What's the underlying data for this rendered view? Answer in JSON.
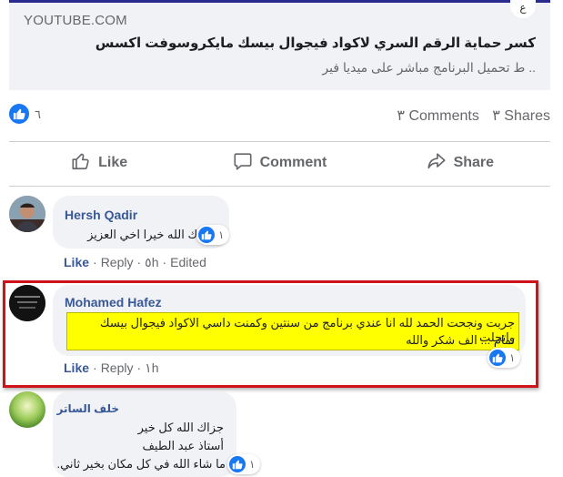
{
  "preview": {
    "domain": "YOUTUBE.COM",
    "corner": "ع",
    "title": "كسر حماية الرقم السري لاكواد فيجوال بيسك مايكروسوفت اكسس",
    "description": ".. ط تحميل البرنامج مباشر على ميديا فير"
  },
  "summary": {
    "reactions_count": "٦",
    "comments": "٣ Comments",
    "shares": "٣ Shares"
  },
  "actions": {
    "like": "Like",
    "comment": "Comment",
    "share": "Share"
  },
  "comments": [
    {
      "name": "Hersh Qadir",
      "text": "جزاك الله خيرا اخي العزيز",
      "reactions": "١",
      "like": "Like",
      "reply": "Reply",
      "time": "٥h",
      "edited": "Edited"
    },
    {
      "name": "Mohamed Hafez",
      "text_line1": "جربت ونجحت الحمد لله انا عندي برنامج من سنتين وكمنت داسي الاكواد فيجوال بيسك واتحلت",
      "text_line2": "تمام ... الف شكر والله",
      "reactions": "١",
      "like": "Like",
      "reply": "Reply",
      "time": "١h"
    },
    {
      "name": "خلف الساتر",
      "line1": "جزاك الله كل خير",
      "line2": "أستاذ عبد الطيف",
      "line3": "ما شاء الله في كل مكان بخير ثاني.",
      "reactions": "١"
    }
  ],
  "colors": {
    "accent": "#1877f2",
    "link": "#385898",
    "highlight_border": "#d0131a",
    "highlight_fill": "#ffff00"
  }
}
